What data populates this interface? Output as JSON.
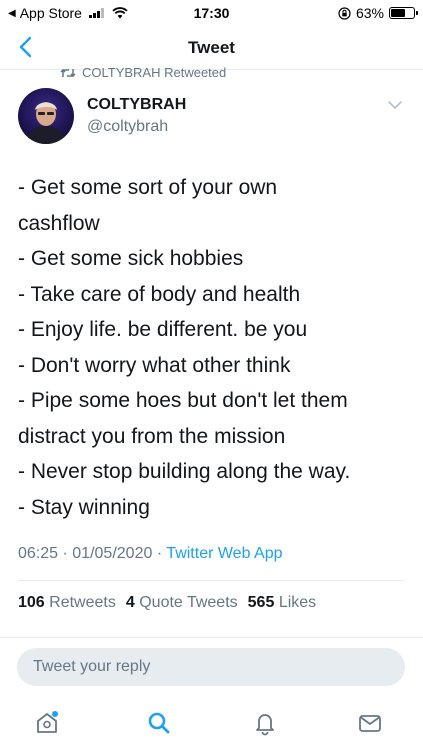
{
  "status_bar": {
    "back_app": "App Store",
    "time": "17:30",
    "battery_percent": "63%",
    "battery_level": 0.63
  },
  "nav": {
    "title": "Tweet"
  },
  "retweet_banner": {
    "text": "COLTYBRAH Retweeted"
  },
  "author": {
    "name": "COLTYBRAH",
    "handle": "@coltybrah"
  },
  "tweet": {
    "lines": [
      "- Get some sort of your own",
      "cashflow",
      "- Get some sick hobbies",
      "- Take care of body and health",
      "- Enjoy life. be different. be you",
      "- Don't worry what other think",
      "- Pipe some hoes but don't let them",
      "distract you from the mission",
      "- Never stop building along the way.",
      "- Stay winning"
    ],
    "time": "06:25",
    "date": "01/05/2020",
    "separator": "·",
    "source": "Twitter Web App"
  },
  "stats": {
    "retweets_count": "106",
    "retweets_label": "Retweets",
    "quotes_count": "4",
    "quotes_label": "Quote Tweets",
    "likes_count": "565",
    "likes_label": "Likes"
  },
  "reply": {
    "placeholder": "Tweet your reply",
    "value": ""
  },
  "tab_bar": {
    "icons": [
      "home-icon",
      "search-icon",
      "notifications-icon",
      "messages-icon"
    ],
    "accent": "#1da1f2"
  },
  "colors": {
    "accent": "#1da1f2",
    "text": "#14171a",
    "secondary": "#657786",
    "divider": "#e6ecf0"
  }
}
